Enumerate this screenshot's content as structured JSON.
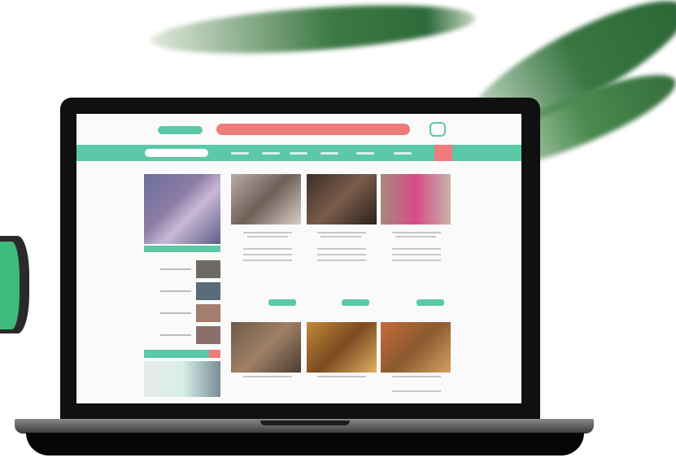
{
  "colors": {
    "accent": "#5bc8a8",
    "banner": "#ef7b7b",
    "laptop": "#101010",
    "leaf": "#3f7a45"
  },
  "icons": {
    "site_logo": "logo-icon",
    "header_icon": "brand-mark-icon",
    "plant": "plant-icon"
  }
}
